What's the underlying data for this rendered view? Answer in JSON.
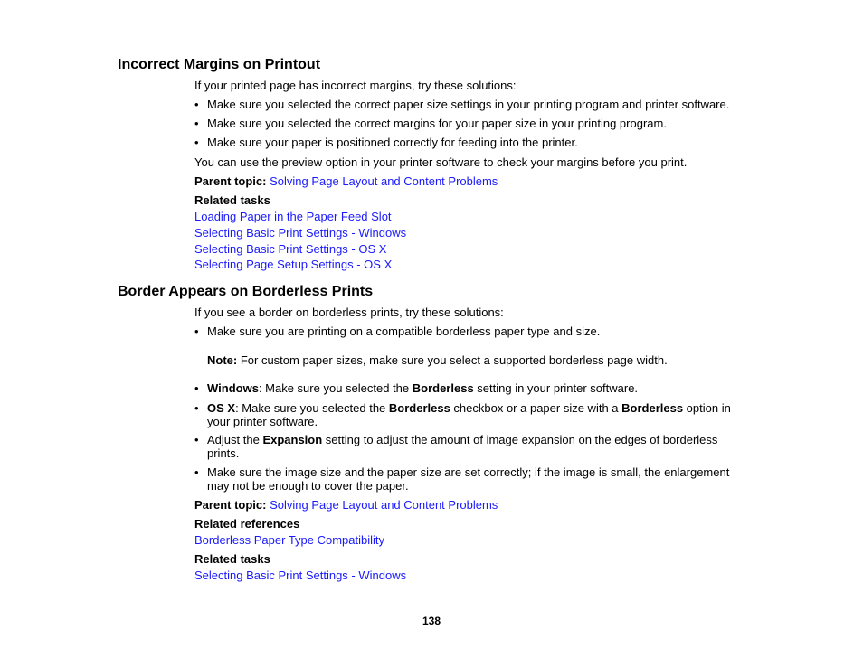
{
  "section1": {
    "title": "Incorrect Margins on Printout",
    "intro": "If your printed page has incorrect margins, try these solutions:",
    "bullets": [
      "Make sure you selected the correct paper size settings in your printing program and printer software.",
      "Make sure you selected the correct margins for your paper size in your printing program.",
      "Make sure your paper is positioned correctly for feeding into the printer."
    ],
    "closing": "You can use the preview option in your printer software to check your margins before you print.",
    "parent_topic_label": "Parent topic:",
    "parent_topic_link": "Solving Page Layout and Content Problems",
    "related_tasks_label": "Related tasks",
    "related_tasks": [
      "Loading Paper in the Paper Feed Slot",
      "Selecting Basic Print Settings - Windows",
      "Selecting Basic Print Settings - OS X",
      "Selecting Page Setup Settings - OS X"
    ]
  },
  "section2": {
    "title": "Border Appears on Borderless Prints",
    "intro": "If you see a border on borderless prints, try these solutions:",
    "bullet1": "Make sure you are printing on a compatible borderless paper type and size.",
    "note_label": "Note:",
    "note_text": " For custom paper sizes, make sure you select a supported borderless page width.",
    "bullet_windows": {
      "b1": "Windows",
      "t1": ": Make sure you selected the ",
      "b2": "Borderless",
      "t2": " setting in your printer software."
    },
    "bullet_osx": {
      "b1": "OS X",
      "t1": ": Make sure you selected the ",
      "b2": "Borderless",
      "t2": " checkbox or a paper size with a ",
      "b3": "Borderless",
      "t3": " option in your printer software."
    },
    "bullet_expansion": {
      "t1": "Adjust the ",
      "b1": "Expansion",
      "t2": " setting to adjust the amount of image expansion on the edges of borderless prints."
    },
    "bullet_size": "Make sure the image size and the paper size are set correctly; if the image is small, the enlargement may not be enough to cover the paper.",
    "parent_topic_label": "Parent topic:",
    "parent_topic_link": "Solving Page Layout and Content Problems",
    "related_references_label": "Related references",
    "related_references": [
      "Borderless Paper Type Compatibility"
    ],
    "related_tasks_label": "Related tasks",
    "related_tasks": [
      "Selecting Basic Print Settings - Windows"
    ]
  },
  "page_number": "138",
  "colors": {
    "link": "#1a1aff",
    "text": "#000000"
  }
}
